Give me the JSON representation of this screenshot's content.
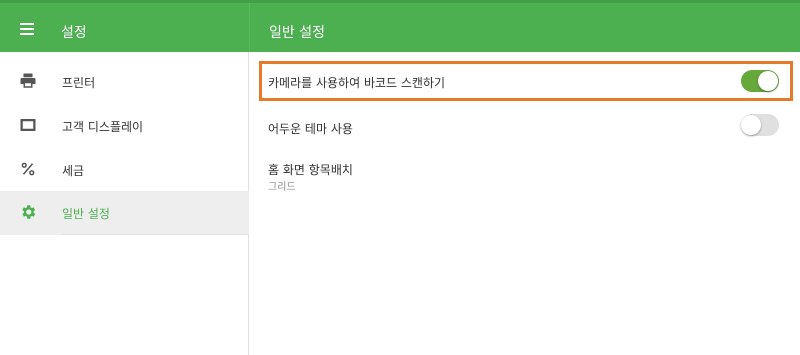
{
  "header": {
    "left_title": "설정",
    "right_title": "일반 설정"
  },
  "sidebar": {
    "items": [
      {
        "label": "프린터",
        "icon": "printer-icon"
      },
      {
        "label": "고객 디스플레이",
        "icon": "display-icon"
      },
      {
        "label": "세금",
        "icon": "percent-icon"
      },
      {
        "label": "일반 설정",
        "icon": "gear-icon",
        "active": true
      }
    ]
  },
  "settings": {
    "barcode_camera": {
      "label": "카메라를 사용하여 바코드 스캔하기",
      "enabled": true
    },
    "dark_theme": {
      "label": "어두운 테마 사용",
      "enabled": false
    },
    "home_layout": {
      "label": "홈 화면 항목배치",
      "value": "그리드"
    }
  },
  "colors": {
    "primary": "#4caf50",
    "toggle_on": "#66a83a",
    "focus_outline": "#e57a29"
  }
}
